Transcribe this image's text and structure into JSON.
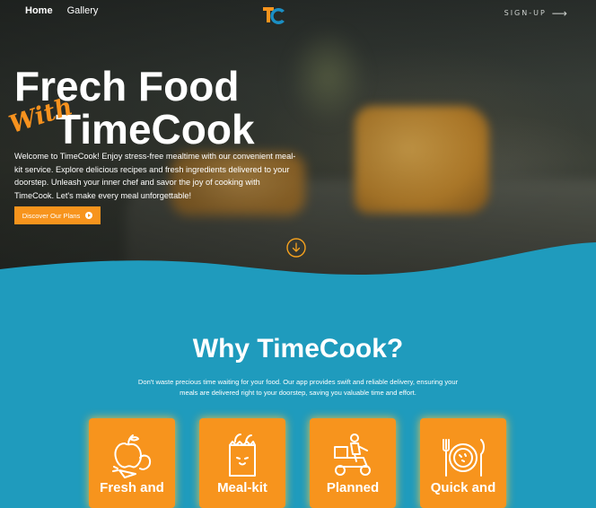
{
  "nav": {
    "home": "Home",
    "gallery": "Gallery",
    "signup": "SIGN-UP"
  },
  "hero": {
    "title_line1": "Frech Food",
    "title_with": "With",
    "title_line2": "TimeCook",
    "description": "Welcome to TimeCook! Enjoy stress-free mealtime with our convenient meal-kit service. Explore delicious recipes and fresh ingredients delivered to your doorstep. Unleash your inner chef and savor the joy of cooking with TimeCook. Let's make every meal unforgettable!",
    "cta_label": "Discover Our Plans"
  },
  "why": {
    "title": "Why TimeCook?",
    "description": "Don't waste precious time waiting for your food. Our app provides swift and reliable delivery, ensuring your meals are delivered right to your doorstep, saving you valuable time and effort.",
    "cards": [
      {
        "label": "Fresh and",
        "icon": "fresh-produce-icon"
      },
      {
        "label": "Meal-kit",
        "icon": "meal-kit-bag-icon"
      },
      {
        "label": "Planned",
        "icon": "delivery-scooter-icon"
      },
      {
        "label": "Quick and",
        "icon": "plate-cutlery-icon"
      }
    ]
  },
  "colors": {
    "accent": "#f7941d",
    "section_bg": "#1f9bbd",
    "logo_blue": "#1b8fc4"
  }
}
